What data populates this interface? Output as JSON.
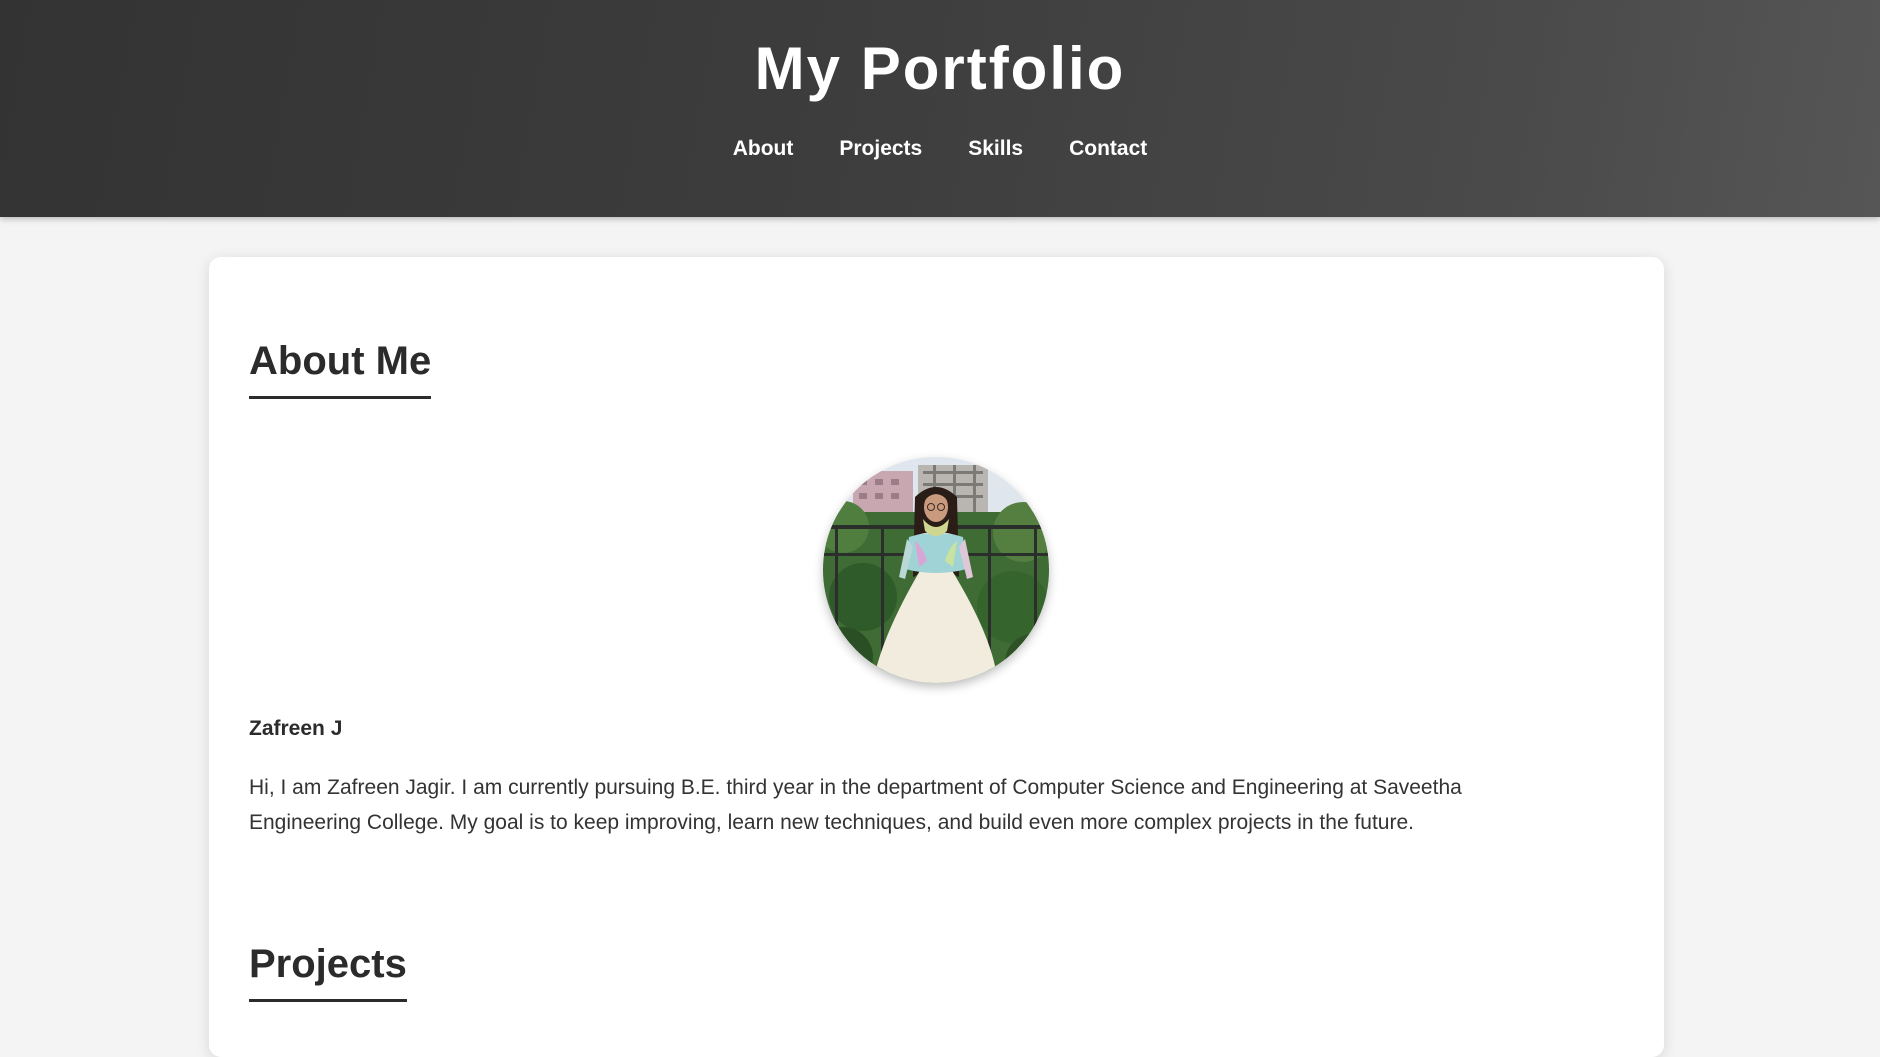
{
  "header": {
    "title": "My Portfolio",
    "nav": [
      {
        "label": "About"
      },
      {
        "label": "Projects"
      },
      {
        "label": "Skills"
      },
      {
        "label": "Contact"
      }
    ]
  },
  "about": {
    "heading": "About Me",
    "name": "Zafreen J",
    "bio": "Hi, I am Zafreen Jagir. I am currently pursuing B.E. third year in the department of Computer Science and Engineering at Saveetha Engineering College. My goal is to keep improving, learn new techniques, and build even more complex projects in the future."
  },
  "projects": {
    "heading": "Projects"
  },
  "colors": {
    "header_bg": "#3d3d3d",
    "page_bg": "#f4f4f4",
    "card_bg": "#ffffff",
    "text": "#2b2b2b"
  }
}
